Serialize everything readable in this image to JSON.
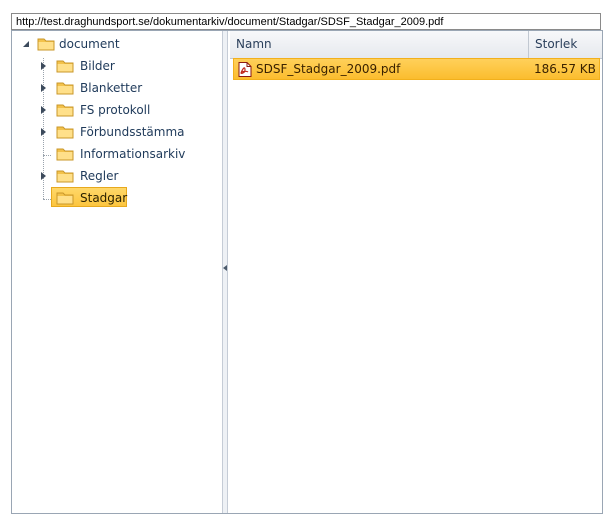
{
  "url": "http://test.draghundsport.se/dokumentarkiv/document/Stadgar/SDSF_Stadgar_2009.pdf",
  "tree": {
    "root": {
      "label": "document",
      "icon": "folder-icon",
      "expanded": true
    },
    "children": [
      {
        "label": "Bilder",
        "icon": "folder-icon",
        "has_children": true
      },
      {
        "label": "Blanketter",
        "icon": "folder-icon",
        "has_children": true
      },
      {
        "label": "FS protokoll",
        "icon": "folder-icon",
        "has_children": true
      },
      {
        "label": "Förbundsstämma",
        "icon": "folder-icon",
        "has_children": true
      },
      {
        "label": "Informationsarkiv",
        "icon": "folder-icon",
        "has_children": false
      },
      {
        "label": "Regler",
        "icon": "folder-icon",
        "has_children": true
      },
      {
        "label": "Stadgar",
        "icon": "folder-icon",
        "has_children": false,
        "selected": true
      }
    ]
  },
  "grid": {
    "columns": {
      "name": "Namn",
      "size": "Storlek"
    },
    "rows": [
      {
        "name": "SDSF_Stadgar_2009.pdf",
        "size": "186.57 KB",
        "icon": "pdf-icon",
        "selected": true
      }
    ]
  },
  "colors": {
    "selection": "#fcc53f",
    "text": "#1f3a5a"
  }
}
